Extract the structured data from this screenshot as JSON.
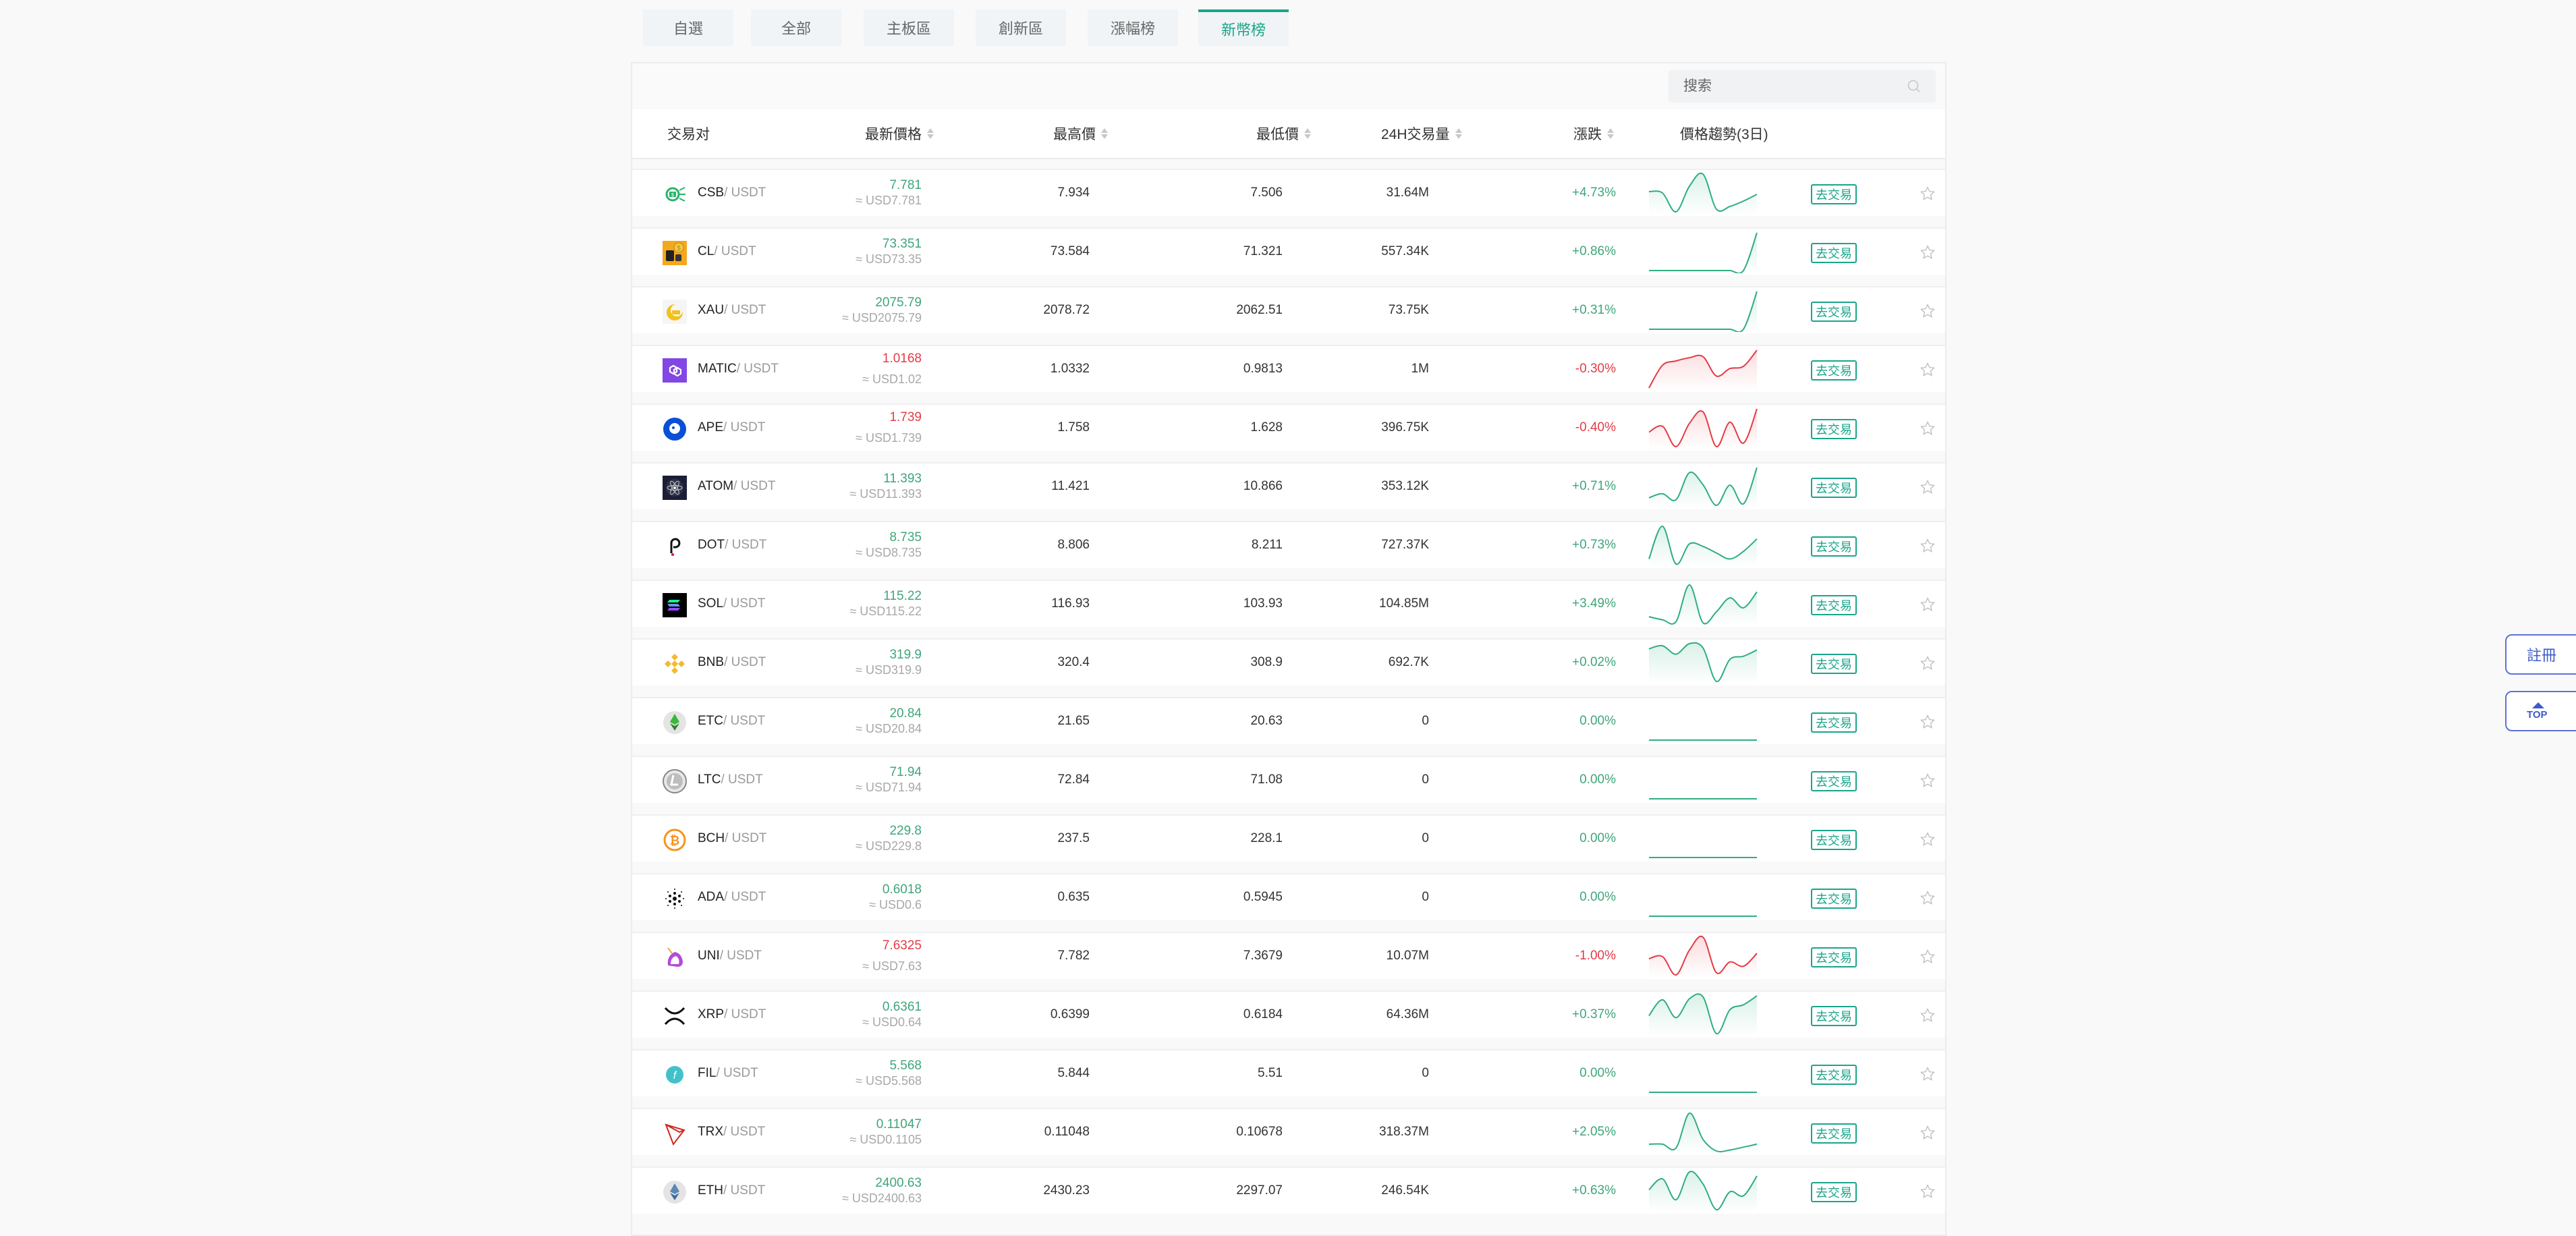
{
  "tabs": [
    {
      "label": "自選",
      "active": false
    },
    {
      "label": "全部",
      "active": false
    },
    {
      "label": "主板區",
      "active": false
    },
    {
      "label": "創新區",
      "active": false
    },
    {
      "label": "漲幅榜",
      "active": false
    },
    {
      "label": "新幣榜",
      "active": true
    }
  ],
  "search": {
    "placeholder": "搜索",
    "icon": "search-icon"
  },
  "columns": {
    "pair": "交易对",
    "last_price": "最新價格",
    "high": "最高價",
    "low": "最低價",
    "volume": "24H交易量",
    "change": "漲跌",
    "trend": "價格趨勢(3日)"
  },
  "colors": {
    "up": "#3fa57a",
    "down": "#e33b46",
    "accent": "#1aa58a",
    "float_btn": "#3f5bc8"
  },
  "trade_label": "去交易",
  "rows": [
    {
      "base": "CSB",
      "quote": "/ USDT",
      "icon": "csb-coin-icon",
      "last": "7.781",
      "usd": "≈ USD7.781",
      "high": "7.934",
      "low": "7.506",
      "volume": "31.64M",
      "change": "+4.73%",
      "dir": "up",
      "trend": [
        5.2,
        5.0,
        2.2,
        6.0,
        7.8,
        2.6,
        3.0,
        3.8,
        4.8
      ]
    },
    {
      "base": "CL",
      "quote": "/ USDT",
      "icon": "cl-coin-icon",
      "last": "73.351",
      "usd": "≈ USD73.35",
      "high": "73.584",
      "low": "71.321",
      "volume": "557.34K",
      "change": "+0.86%",
      "dir": "up",
      "trend": [
        1,
        1,
        1,
        1,
        1,
        1,
        1,
        1,
        9
      ]
    },
    {
      "base": "XAU",
      "quote": "/ USDT",
      "icon": "xau-coin-icon",
      "last": "2075.79",
      "usd": "≈ USD2075.79",
      "high": "2078.72",
      "low": "2062.51",
      "volume": "73.75K",
      "change": "+0.31%",
      "dir": "up",
      "trend": [
        1,
        1,
        1,
        1,
        1,
        1,
        1,
        1,
        9
      ]
    },
    {
      "base": "MATIC",
      "quote": "/ USDT",
      "icon": "matic-coin-icon",
      "last": "1.0168",
      "usd": "≈ USD1.02",
      "high": "1.0332",
      "low": "0.9813",
      "volume": "1M",
      "change": "-0.30%",
      "dir": "down",
      "trend": [
        1.0,
        5.2,
        6.0,
        6.6,
        6.8,
        3.2,
        4.6,
        5.0,
        8.0
      ]
    },
    {
      "base": "APE",
      "quote": "/ USDT",
      "icon": "ape-coin-icon",
      "last": "1.739",
      "usd": "≈ USD1.739",
      "high": "1.758",
      "low": "1.628",
      "volume": "396.75K",
      "change": "-0.40%",
      "dir": "down",
      "trend": [
        4.5,
        5.5,
        2.0,
        6.0,
        8.0,
        2.0,
        6.2,
        2.6,
        8.5
      ]
    },
    {
      "base": "ATOM",
      "quote": "/ USDT",
      "icon": "atom-coin-icon",
      "last": "11.393",
      "usd": "≈ USD11.393",
      "high": "11.421",
      "low": "10.866",
      "volume": "353.12K",
      "change": "+0.71%",
      "dir": "up",
      "trend": [
        3.0,
        3.8,
        2.6,
        8.0,
        5.6,
        1.5,
        5.5,
        1.8,
        9.0
      ]
    },
    {
      "base": "DOT",
      "quote": "/ USDT",
      "icon": "dot-coin-icon",
      "last": "8.735",
      "usd": "≈ USD8.735",
      "high": "8.806",
      "low": "8.211",
      "volume": "727.37K",
      "change": "+0.73%",
      "dir": "up",
      "trend": [
        2.0,
        8.5,
        1.0,
        5.0,
        4.5,
        3.2,
        2.0,
        3.5,
        6.0
      ]
    },
    {
      "base": "SOL",
      "quote": "/ USDT",
      "icon": "sol-coin-icon",
      "last": "115.22",
      "usd": "≈ USD115.22",
      "high": "116.93",
      "low": "103.93",
      "volume": "104.85M",
      "change": "+3.49%",
      "dir": "up",
      "trend": [
        2.6,
        2.0,
        1.6,
        9.0,
        1.4,
        3.6,
        6.4,
        4.4,
        7.6
      ]
    },
    {
      "base": "BNB",
      "quote": "/ USDT",
      "icon": "bnb-coin-icon",
      "last": "319.9",
      "usd": "≈ USD319.9",
      "high": "320.4",
      "low": "308.9",
      "volume": "692.7K",
      "change": "+0.02%",
      "dir": "up",
      "trend": [
        7.2,
        7.8,
        6.2,
        8.2,
        7.4,
        1.0,
        5.2,
        5.8,
        7.0
      ]
    },
    {
      "base": "ETC",
      "quote": "/ USDT",
      "icon": "etc-coin-icon",
      "last": "20.84",
      "usd": "≈ USD20.84",
      "high": "21.65",
      "low": "20.63",
      "volume": "0",
      "change": "0.00%",
      "dir": "up",
      "trend": [
        0,
        0,
        0,
        0,
        0,
        0,
        0,
        0,
        0
      ]
    },
    {
      "base": "LTC",
      "quote": "/ USDT",
      "icon": "ltc-coin-icon",
      "last": "71.94",
      "usd": "≈ USD71.94",
      "high": "72.84",
      "low": "71.08",
      "volume": "0",
      "change": "0.00%",
      "dir": "up",
      "trend": [
        0,
        0,
        0,
        0,
        0,
        0,
        0,
        0,
        0
      ]
    },
    {
      "base": "BCH",
      "quote": "/ USDT",
      "icon": "bch-coin-icon",
      "last": "229.8",
      "usd": "≈ USD229.8",
      "high": "237.5",
      "low": "228.1",
      "volume": "0",
      "change": "0.00%",
      "dir": "up",
      "trend": [
        0,
        0,
        0,
        0,
        0,
        0,
        0,
        0,
        0
      ]
    },
    {
      "base": "ADA",
      "quote": "/ USDT",
      "icon": "ada-coin-icon",
      "last": "0.6018",
      "usd": "≈ USD0.6",
      "high": "0.635",
      "low": "0.5945",
      "volume": "0",
      "change": "0.00%",
      "dir": "up",
      "trend": [
        0,
        0,
        0,
        0,
        0,
        0,
        0,
        0,
        0
      ]
    },
    {
      "base": "UNI",
      "quote": "/ USDT",
      "icon": "uni-coin-icon",
      "last": "7.6325",
      "usd": "≈ USD7.63",
      "high": "7.782",
      "low": "7.3679",
      "volume": "10.07M",
      "change": "-1.00%",
      "dir": "down",
      "trend": [
        4.6,
        5.0,
        1.6,
        6.2,
        8.6,
        2.0,
        4.0,
        3.2,
        5.6
      ]
    },
    {
      "base": "XRP",
      "quote": "/ USDT",
      "icon": "xrp-coin-icon",
      "last": "0.6361",
      "usd": "≈ USD0.64",
      "high": "0.6399",
      "low": "0.6184",
      "volume": "64.36M",
      "change": "+0.37%",
      "dir": "up",
      "trend": [
        4.4,
        7.6,
        4.0,
        7.8,
        8.2,
        0.8,
        5.6,
        6.6,
        8.4
      ]
    },
    {
      "base": "FIL",
      "quote": "/ USDT",
      "icon": "fil-coin-icon",
      "last": "5.568",
      "usd": "≈ USD5.568",
      "high": "5.844",
      "low": "5.51",
      "volume": "0",
      "change": "0.00%",
      "dir": "up",
      "trend": [
        0,
        0,
        0,
        0,
        0,
        0,
        0,
        0,
        0
      ]
    },
    {
      "base": "TRX",
      "quote": "/ USDT",
      "icon": "trx-coin-icon",
      "last": "0.11047",
      "usd": "≈ USD0.1105",
      "high": "0.11048",
      "low": "0.10678",
      "volume": "318.37M",
      "change": "+2.05%",
      "dir": "up",
      "trend": [
        2.6,
        2.6,
        1.8,
        9.0,
        3.6,
        1.2,
        1.4,
        2.0,
        2.6
      ]
    },
    {
      "base": "ETH",
      "quote": "/ USDT",
      "icon": "eth-coin-icon",
      "last": "2400.63",
      "usd": "≈ USD2400.63",
      "high": "2430.23",
      "low": "2297.07",
      "volume": "246.54K",
      "change": "+0.63%",
      "dir": "up",
      "trend": [
        5.0,
        7.2,
        3.0,
        8.6,
        6.2,
        1.0,
        4.6,
        3.8,
        7.8
      ]
    }
  ],
  "float": {
    "register_label": "註冊",
    "top_label": "TOP"
  }
}
